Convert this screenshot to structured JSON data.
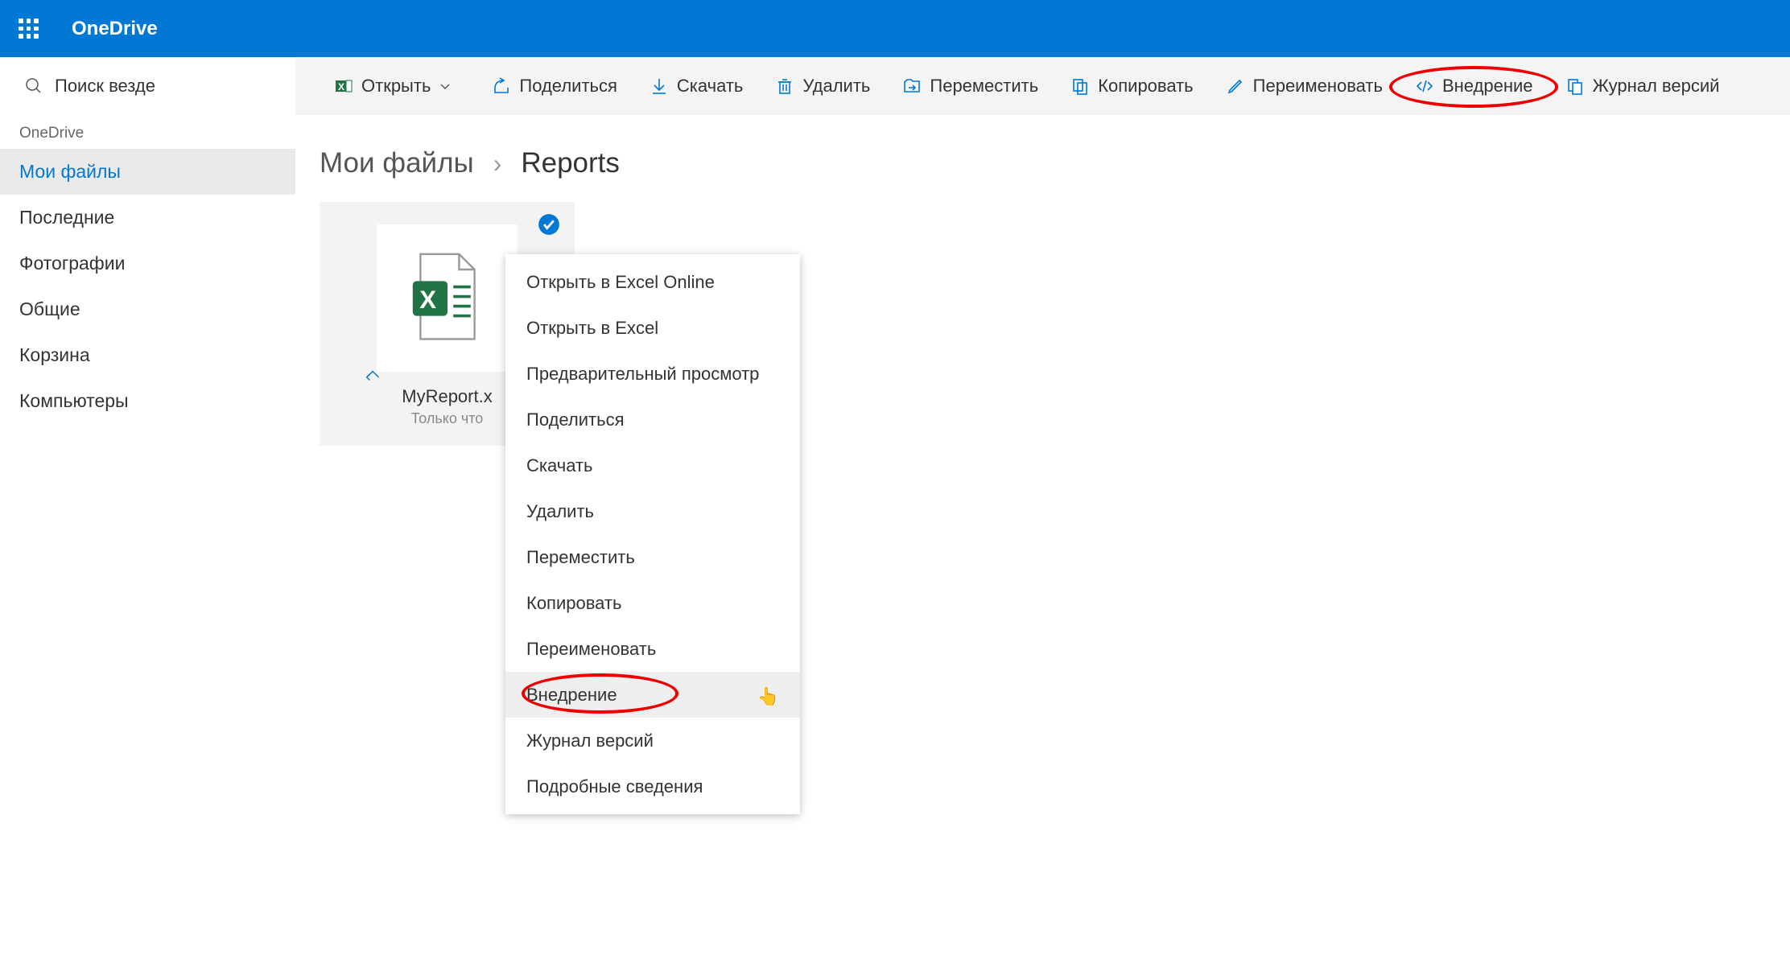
{
  "header": {
    "brand": "OneDrive"
  },
  "search": {
    "placeholder": "Поиск везде"
  },
  "nav": {
    "account": "OneDrive",
    "items": [
      {
        "label": "Мои файлы",
        "active": true
      },
      {
        "label": "Последние",
        "active": false
      },
      {
        "label": "Фотографии",
        "active": false
      },
      {
        "label": "Общие",
        "active": false
      },
      {
        "label": "Корзина",
        "active": false
      },
      {
        "label": "Компьютеры",
        "active": false
      }
    ]
  },
  "toolbar": {
    "open": "Открыть",
    "share": "Поделиться",
    "download": "Скачать",
    "delete": "Удалить",
    "move": "Переместить",
    "copy": "Копировать",
    "rename": "Переименовать",
    "embed": "Внедрение",
    "history": "Журнал версий"
  },
  "breadcrumbs": [
    "Мои файлы",
    "Reports"
  ],
  "file": {
    "name": "MyReport.x",
    "time": "Только что"
  },
  "context_menu": {
    "items": [
      {
        "label": "Открыть в Excel Online"
      },
      {
        "label": "Открыть в Excel"
      },
      {
        "label": "Предварительный просмотр"
      },
      {
        "label": "Поделиться"
      },
      {
        "label": "Скачать"
      },
      {
        "label": "Удалить"
      },
      {
        "label": "Переместить"
      },
      {
        "label": "Копировать"
      },
      {
        "label": "Переименовать"
      },
      {
        "label": "Внедрение",
        "hover": true
      },
      {
        "label": "Журнал версий"
      },
      {
        "label": "Подробные сведения"
      }
    ]
  }
}
